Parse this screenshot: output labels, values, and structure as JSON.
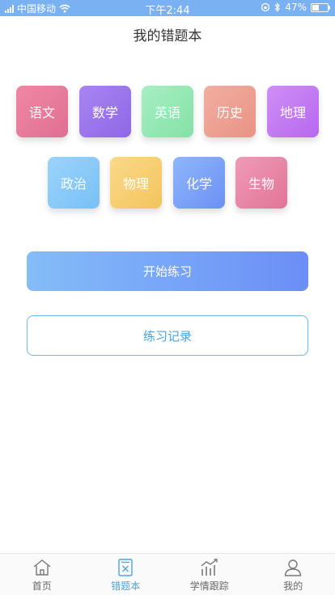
{
  "status": {
    "carrier": "中国移动",
    "time": "下午2:44",
    "battery": "47%",
    "battery_level": 0.47
  },
  "header": {
    "title": "我的错题本"
  },
  "subjects": [
    {
      "label": "语文",
      "color_from": "#ef88a4",
      "color_to": "#e06f93"
    },
    {
      "label": "数学",
      "color_from": "#a885f2",
      "color_to": "#8f67e6"
    },
    {
      "label": "英语",
      "color_from": "#a7efc2",
      "color_to": "#84e1a6"
    },
    {
      "label": "历史",
      "color_from": "#f2aea0",
      "color_to": "#e89385"
    },
    {
      "label": "地理",
      "color_from": "#cf8ff5",
      "color_to": "#b668ef"
    },
    {
      "label": "政治",
      "color_from": "#9bd4fb",
      "color_to": "#79c0f6"
    },
    {
      "label": "物理",
      "color_from": "#fbd98a",
      "color_to": "#f3c45c"
    },
    {
      "label": "化学",
      "color_from": "#8fb7fb",
      "color_to": "#6c90f4"
    },
    {
      "label": "生物",
      "color_from": "#f09ab7",
      "color_to": "#e17497"
    }
  ],
  "buttons": {
    "start": "开始练习",
    "record": "练习记录"
  },
  "tabs": [
    {
      "label": "首页",
      "icon": "home-icon",
      "active": false
    },
    {
      "label": "错题本",
      "icon": "wrong-book-icon",
      "active": true
    },
    {
      "label": "学情跟踪",
      "icon": "trend-chart-icon",
      "active": false
    },
    {
      "label": "我的",
      "icon": "user-icon",
      "active": false
    }
  ],
  "colors": {
    "accent": "#4aa3e6",
    "status_bar": "#7ab1f2"
  }
}
